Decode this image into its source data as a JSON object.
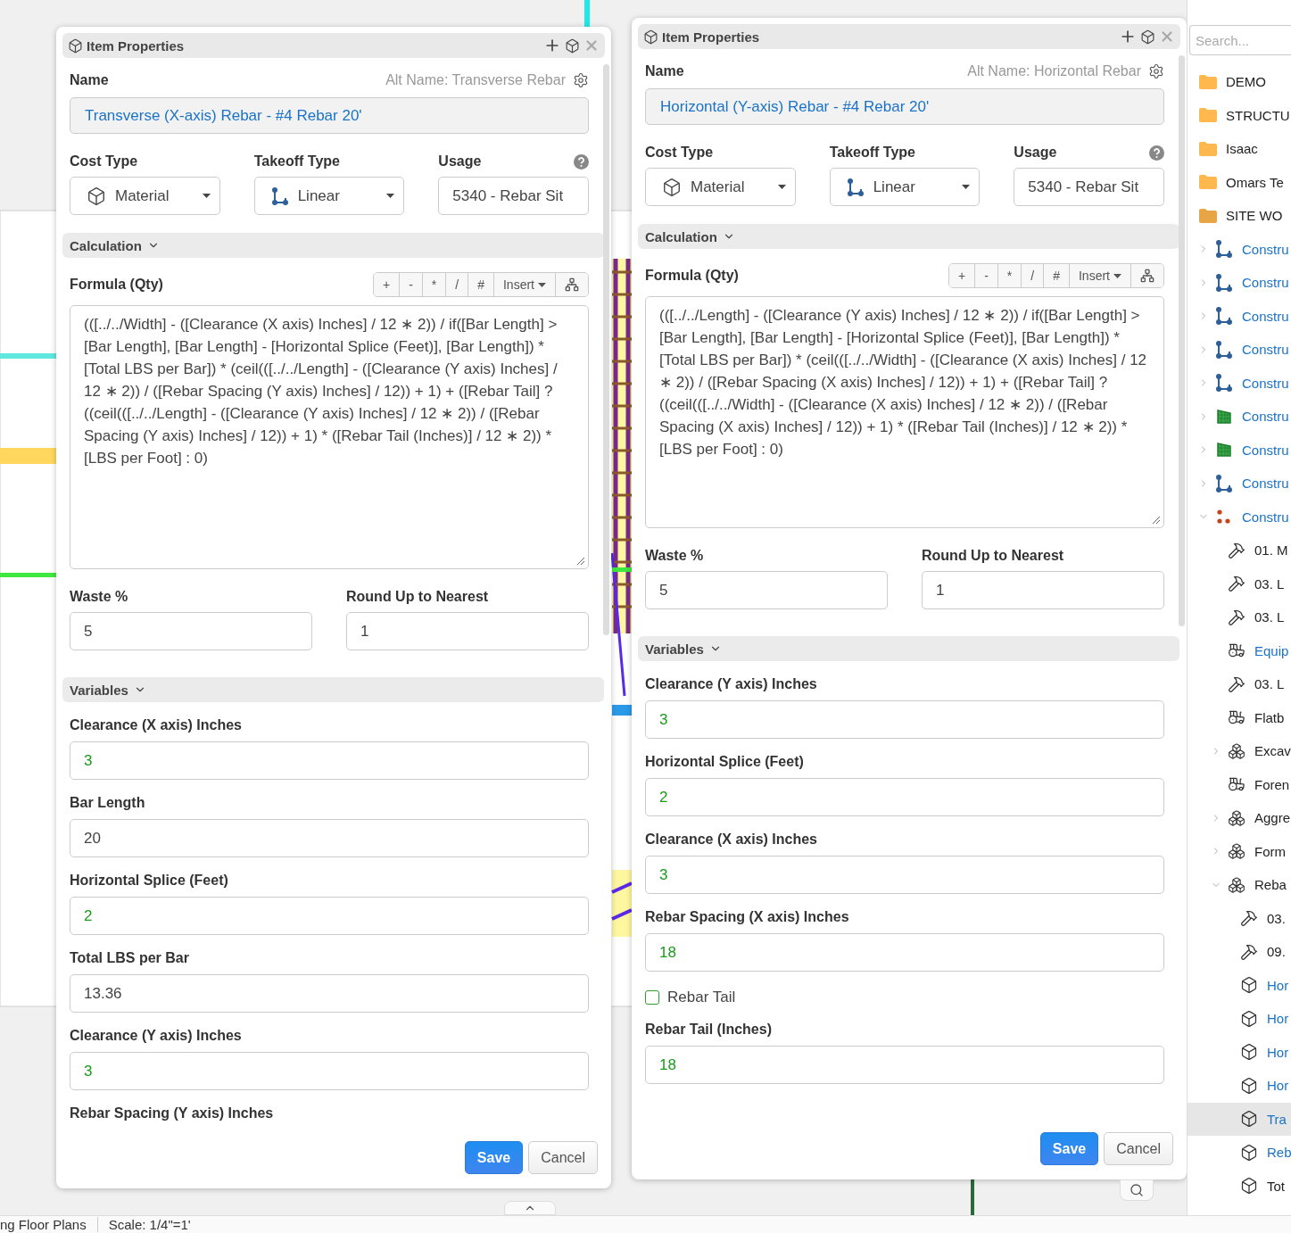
{
  "panels": [
    {
      "title": "Item Properties",
      "name_label": "Name",
      "alt_name": "Alt Name: Transverse Rebar",
      "name_value": "Transverse (X-axis) Rebar - #4 Rebar 20'",
      "cost_type": {
        "label": "Cost Type",
        "value": "Material"
      },
      "takeoff_type": {
        "label": "Takeoff Type",
        "value": "Linear"
      },
      "usage": {
        "label": "Usage",
        "value": "5340 - Rebar Sit"
      },
      "calculation_header": "Calculation",
      "formula": {
        "label": "Formula (Qty)",
        "operators": [
          "+",
          "-",
          "*",
          "/",
          "#"
        ],
        "insert": "Insert",
        "value": "(([../../Width] - ([Clearance (X axis) Inches] / 12 ∗ 2)) / if([Bar Length] > [Bar Length], [Bar Length] - [Horizontal Splice (Feet)], [Bar Length]) * [Total LBS per Bar]) * (ceil(([../../Length] - ([Clearance (Y axis) Inches] / 12 ∗ 2)) / ([Rebar Spacing (Y axis) Inches] / 12)) + 1) + ([Rebar Tail] ? ((ceil(([../../Length] - ([Clearance (Y axis) Inches] / 12 ∗ 2)) / ([Rebar Spacing (Y axis) Inches] / 12)) + 1) * ([Rebar Tail (Inches)] / 12 ∗ 2)) * [LBS per Foot] : 0)"
      },
      "waste": {
        "label": "Waste %",
        "value": "5"
      },
      "round_up": {
        "label": "Round Up to Nearest",
        "value": "1"
      },
      "variables_header": "Variables",
      "variables": [
        {
          "kind": "number",
          "label": "Clearance (X axis) Inches",
          "value": "3",
          "overridden": true
        },
        {
          "kind": "number",
          "label": "Bar Length",
          "value": "20",
          "overridden": false
        },
        {
          "kind": "number",
          "label": "Horizontal Splice (Feet)",
          "value": "2",
          "overridden": true
        },
        {
          "kind": "number",
          "label": "Total LBS per Bar",
          "value": "13.36",
          "overridden": false
        },
        {
          "kind": "number",
          "label": "Clearance (Y axis) Inches",
          "value": "3",
          "overridden": true
        },
        {
          "kind": "number",
          "label": "Rebar Spacing (Y axis) Inches"
        }
      ],
      "save": "Save",
      "cancel": "Cancel"
    },
    {
      "title": "Item Properties",
      "name_label": "Name",
      "alt_name": "Alt Name: Horizontal Rebar",
      "name_value": "Horizontal (Y-axis) Rebar - #4 Rebar 20'",
      "cost_type": {
        "label": "Cost Type",
        "value": "Material"
      },
      "takeoff_type": {
        "label": "Takeoff Type",
        "value": "Linear"
      },
      "usage": {
        "label": "Usage",
        "value": "5340 - Rebar Sit"
      },
      "calculation_header": "Calculation",
      "formula": {
        "label": "Formula (Qty)",
        "operators": [
          "+",
          "-",
          "*",
          "/",
          "#"
        ],
        "insert": "Insert",
        "value": "(([../../Length] - ([Clearance (Y axis) Inches] / 12 ∗ 2)) / if([Bar Length] > [Bar Length], [Bar Length] - [Horizontal Splice (Feet)], [Bar Length]) * [Total LBS per Bar]) * (ceil(([../../Width] - ([Clearance (X axis) Inches] / 12 ∗ 2)) / ([Rebar Spacing (X axis) Inches] / 12)) + 1) + ([Rebar Tail] ? ((ceil(([../../Width] - ([Clearance (X axis) Inches] / 12 ∗ 2)) / ([Rebar Spacing (X axis) Inches] / 12)) + 1) * ([Rebar Tail (Inches)] / 12 ∗ 2)) * [LBS per Foot] : 0)"
      },
      "waste": {
        "label": "Waste %",
        "value": "5"
      },
      "round_up": {
        "label": "Round Up to Nearest",
        "value": "1"
      },
      "variables_header": "Variables",
      "variables": [
        {
          "kind": "number",
          "label": "Clearance (Y axis) Inches",
          "value": "3",
          "overridden": true
        },
        {
          "kind": "number",
          "label": "Horizontal Splice (Feet)",
          "value": "2",
          "overridden": true
        },
        {
          "kind": "number",
          "label": "Clearance (X axis) Inches",
          "value": "3",
          "overridden": true
        },
        {
          "kind": "number",
          "label": "Rebar Spacing (X axis) Inches",
          "value": "18",
          "overridden": true
        },
        {
          "kind": "checkbox",
          "label": "Rebar Tail",
          "checked": false
        },
        {
          "kind": "number",
          "label": "Rebar Tail (Inches)",
          "value": "18",
          "overridden": true
        }
      ],
      "save": "Save",
      "cancel": "Cancel"
    }
  ],
  "tree": {
    "search_placeholder": "Search...",
    "items": [
      {
        "kind": "folder",
        "label": "DEMO",
        "linked": false,
        "selected": false
      },
      {
        "kind": "folder",
        "label": "STRUCTU",
        "linked": false,
        "selected": false
      },
      {
        "kind": "folder",
        "label": "Isaac",
        "linked": false,
        "selected": false
      },
      {
        "kind": "folder",
        "label": "Omars Te",
        "linked": false,
        "selected": false
      },
      {
        "kind": "folder",
        "label": "SITE WO",
        "linked": false,
        "selected": false,
        "expanded": true,
        "children": [
          {
            "kind": "linear",
            "label": "Constru",
            "linked": true,
            "selected": false,
            "expanded": false
          },
          {
            "kind": "linear",
            "label": "Constru",
            "linked": true,
            "selected": false,
            "expanded": false
          },
          {
            "kind": "linear",
            "label": "Constru",
            "linked": true,
            "selected": false,
            "expanded": false
          },
          {
            "kind": "linear",
            "label": "Constru",
            "linked": true,
            "selected": false,
            "expanded": false
          },
          {
            "kind": "linear",
            "label": "Constru",
            "linked": true,
            "selected": false,
            "expanded": false
          },
          {
            "kind": "area",
            "label": "Constru",
            "linked": true,
            "selected": false,
            "expanded": false
          },
          {
            "kind": "area",
            "label": "Constru",
            "linked": true,
            "selected": false,
            "expanded": false
          },
          {
            "kind": "linear",
            "label": "Constru",
            "linked": true,
            "selected": false,
            "expanded": false
          },
          {
            "kind": "count",
            "label": "Constru",
            "linked": true,
            "selected": false,
            "expanded": true,
            "children": [
              {
                "kind": "labor",
                "label": "01. M",
                "linked": false,
                "selected": false
              },
              {
                "kind": "labor",
                "label": "03. L",
                "linked": false,
                "selected": false
              },
              {
                "kind": "labor",
                "label": "03. L",
                "linked": false,
                "selected": false
              },
              {
                "kind": "equipment",
                "label": "Equip",
                "linked": true,
                "selected": false
              },
              {
                "kind": "labor",
                "label": "03. L",
                "linked": false,
                "selected": false
              },
              {
                "kind": "equipment",
                "label": "Flatb",
                "linked": false,
                "selected": false
              },
              {
                "kind": "assembly",
                "label": "Excav",
                "linked": false,
                "selected": false,
                "expanded": false
              },
              {
                "kind": "equipment",
                "label": "Foren",
                "linked": false,
                "selected": false
              },
              {
                "kind": "assembly",
                "label": "Aggre",
                "linked": false,
                "selected": false,
                "expanded": false
              },
              {
                "kind": "assembly",
                "label": "Form",
                "linked": false,
                "selected": false,
                "expanded": false
              },
              {
                "kind": "assembly",
                "label": "Reba",
                "linked": false,
                "selected": false,
                "expanded": true,
                "children": [
                  {
                    "kind": "labor",
                    "label": "03.",
                    "linked": false,
                    "selected": false
                  },
                  {
                    "kind": "labor",
                    "label": "09.",
                    "linked": false,
                    "selected": false
                  },
                  {
                    "kind": "item",
                    "label": "Hor",
                    "linked": true,
                    "selected": false
                  },
                  {
                    "kind": "item",
                    "label": "Hor",
                    "linked": true,
                    "selected": false
                  },
                  {
                    "kind": "item",
                    "label": "Hor",
                    "linked": true,
                    "selected": false
                  },
                  {
                    "kind": "item",
                    "label": "Hor",
                    "linked": true,
                    "selected": false
                  },
                  {
                    "kind": "item",
                    "label": "Tra",
                    "linked": true,
                    "selected": true
                  },
                  {
                    "kind": "item",
                    "label": "Reb",
                    "linked": true,
                    "selected": false
                  },
                  {
                    "kind": "item",
                    "label": "Tot",
                    "linked": false,
                    "selected": false
                  }
                ]
              }
            ]
          }
        ]
      }
    ]
  },
  "status_bar": [
    "ng Floor Plans",
    "Scale: 1/4\"=1'"
  ]
}
